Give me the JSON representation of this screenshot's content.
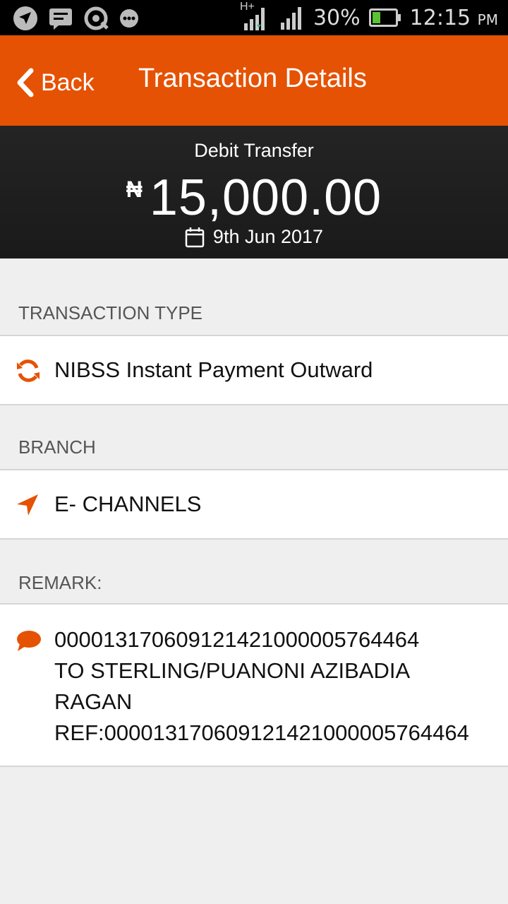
{
  "status_bar": {
    "network": "H+",
    "battery": "30%",
    "time": "12:15",
    "ampm": "PM"
  },
  "app_bar": {
    "back_label": "Back",
    "title": "Transaction Details"
  },
  "summary": {
    "type": "Debit Transfer",
    "currency_symbol": "₦",
    "amount": "15,000.00",
    "date": "9th Jun 2017"
  },
  "sections": {
    "transaction_type": {
      "header": "TRANSACTION TYPE",
      "value": "NIBSS Instant Payment Outward",
      "icon": "refresh-icon"
    },
    "branch": {
      "header": "BRANCH",
      "value": "E- CHANNELS",
      "icon": "location-arrow-icon"
    },
    "remark": {
      "header": "REMARK:",
      "value": "000013170609121421000005764464\nTO STERLING/PUANONI AZIBADIA\nRAGAN\nREF:000013170609121421000005764464",
      "icon": "comment-icon"
    }
  },
  "colors": {
    "accent": "#e55203",
    "status_bar": "#000000",
    "hero": "#1f1f1f",
    "background": "#efefef"
  }
}
